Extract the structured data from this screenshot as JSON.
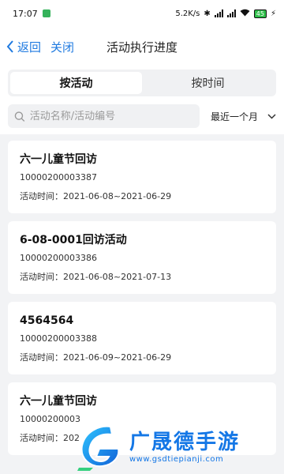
{
  "status_bar": {
    "time": "17:07",
    "network_speed": "5.2K/s",
    "battery": "45"
  },
  "nav": {
    "back_label": "返回",
    "close_label": "关闭",
    "title": "活动执行进度"
  },
  "tabs": [
    {
      "label": "按活动",
      "active": true
    },
    {
      "label": "按时间",
      "active": false
    }
  ],
  "search": {
    "placeholder": "活动名称/活动编号",
    "value": ""
  },
  "period_filter": {
    "selected": "最近一个月"
  },
  "activities": [
    {
      "title": "六一儿童节回访",
      "code": "10000200003387",
      "time_label": "活动时间：",
      "time_range": "2021-06-08~2021-06-29"
    },
    {
      "title": "6-08-0001回访活动",
      "code": "10000200003386",
      "time_label": "活动时间：",
      "time_range": "2021-06-08~2021-07-13"
    },
    {
      "title": "4564564",
      "code": "10000200003388",
      "time_label": "活动时间：",
      "time_range": "2021-06-09~2021-06-29"
    },
    {
      "title": "六一儿童节回访",
      "code": "10000200003",
      "time_label": "活动时间：",
      "time_range": "202"
    }
  ],
  "watermark": {
    "brand": "广晟德手游",
    "url": "www.gsdtiepianji.com"
  },
  "colors": {
    "accent": "#1f7ae0",
    "background": "#f2f3f5",
    "watermark": "#1477e6"
  }
}
